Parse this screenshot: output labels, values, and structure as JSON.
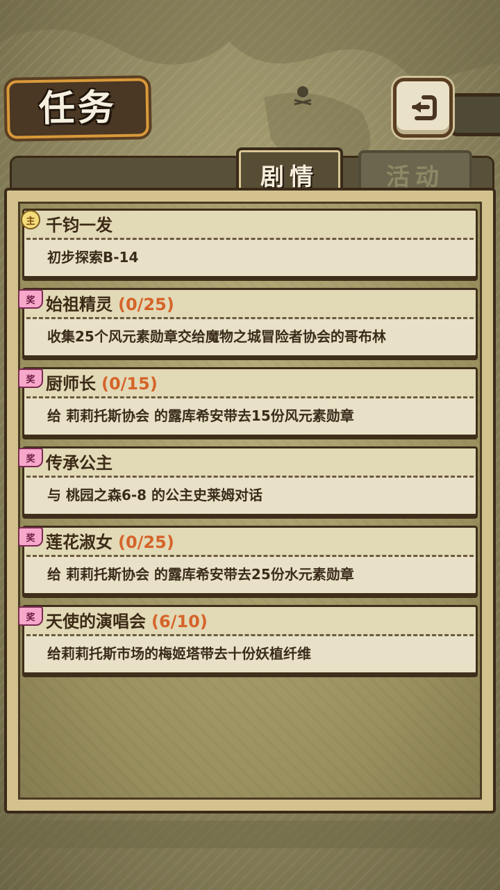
{
  "header": {
    "title": "任务"
  },
  "tabs": [
    {
      "label": "剧情",
      "active": true
    },
    {
      "label": "活动",
      "active": false
    }
  ],
  "badges": {
    "main": "主",
    "side": "奖"
  },
  "quests": [
    {
      "badge": "main",
      "name": "千钧一发",
      "progress": "",
      "desc": "初步探索B-14"
    },
    {
      "badge": "side",
      "name": "始祖精灵",
      "progress": "(0/25)",
      "desc": "收集25个风元素勋章交给魔物之城冒险者协会的哥布林"
    },
    {
      "badge": "side",
      "name": "厨师长",
      "progress": "(0/15)",
      "desc": "给 莉莉托斯协会 的露库希安带去15份风元素勋章"
    },
    {
      "badge": "side",
      "name": "传承公主",
      "progress": "",
      "desc": "与 桃园之森6-8 的公主史莱姆对话"
    },
    {
      "badge": "side",
      "name": "莲花淑女",
      "progress": "(0/25)",
      "desc": "给 莉莉托斯协会 的露库希安带去25份水元素勋章"
    },
    {
      "badge": "side",
      "name": "天使的演唱会",
      "progress": "(6/10)",
      "desc": "给莉莉托斯市场的梅姬塔带去十份妖植纤维"
    }
  ],
  "colors": {
    "progress": "#d5642a",
    "panel": "#d3c28d",
    "frame": "#3a2a18"
  },
  "icons": {
    "back": "back-arrow-icon",
    "decor": "pirate-flag-icon"
  }
}
